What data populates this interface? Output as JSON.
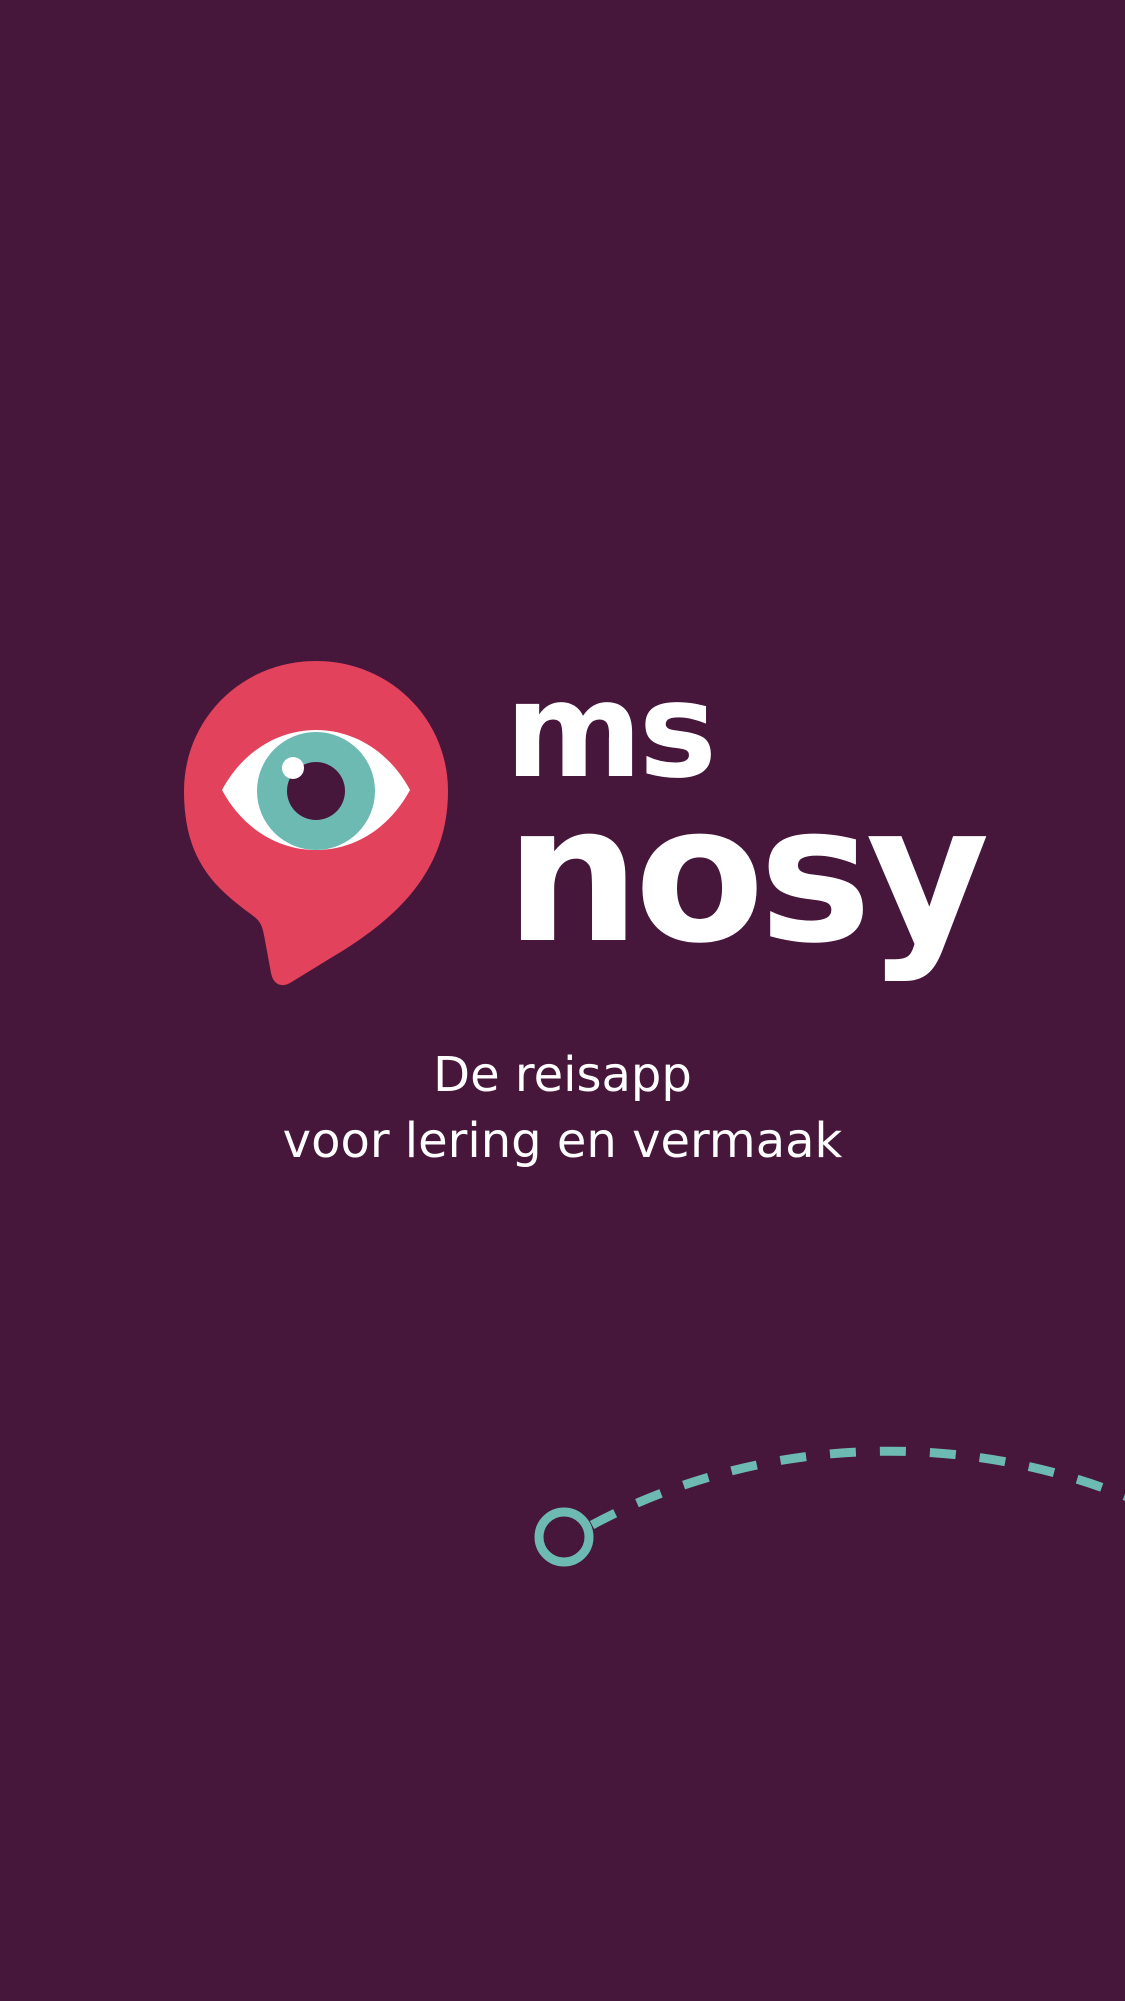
{
  "colors": {
    "background": "#47163b",
    "pin": "#e2425b",
    "eye_white": "#ffffff",
    "iris": "#6dbab3",
    "pupil": "#47163b",
    "text": "#ffffff",
    "route": "#6dbab3"
  },
  "logo": {
    "icon": "eye-pin-icon",
    "word_line1": "ms",
    "word_line2": "nosy"
  },
  "tagline": {
    "line1": "De reisapp",
    "line2": "voor lering en vermaak"
  },
  "route_icon": "dashed-route-icon"
}
